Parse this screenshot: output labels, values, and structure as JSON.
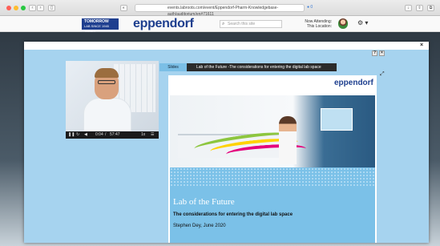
{
  "browser": {
    "url": "events.labroots.com/event/Eppendorf-Pharm-Knowledgebase-auth/auditorium/en#71611",
    "url_status": "● 0"
  },
  "site": {
    "banner_line1": "TOMORROW",
    "banner_line2": "LAB SINCE 1945 TEAMS",
    "logo": "eppendorf",
    "search_placeholder": "Search this site",
    "attending_label": "Now Attending:",
    "location_label": "This Location:"
  },
  "modal": {
    "help": "?",
    "minimize": "×",
    "close": "×"
  },
  "video": {
    "time_current": "0:04",
    "time_separator": "/",
    "time_total": "57:47",
    "speed": "1x"
  },
  "slides": {
    "tab_label": "Slides",
    "presentation_title": "Lab of the Future -The considerations for entering the digital lab space",
    "logo": "eppendorf",
    "title": "Lab of the Future",
    "subtitle": "The considerations for entering the digital lab space",
    "author": "Stephen Dey, June 2020"
  }
}
